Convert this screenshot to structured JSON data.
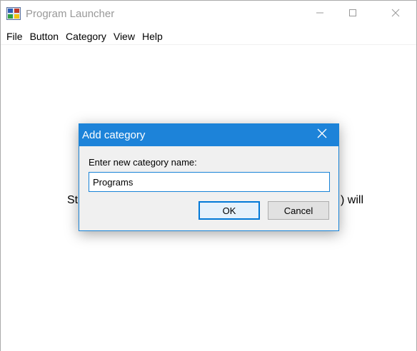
{
  "window": {
    "title": "Program Launcher"
  },
  "menu": {
    "items": [
      "File",
      "Button",
      "Category",
      "View",
      "Help"
    ]
  },
  "background": {
    "text_left": "St",
    "text_right": ") will"
  },
  "dialog": {
    "title": "Add category",
    "prompt": "Enter new category name:",
    "input_value": "Programs",
    "ok_label": "OK",
    "cancel_label": "Cancel"
  },
  "colors": {
    "dialog_titlebar": "#1d83d9",
    "accent": "#0078d7",
    "dialog_bg": "#f0f0f0"
  },
  "icons": {
    "app": "program-launcher-icon",
    "minimize": "minimize-icon",
    "maximize": "maximize-icon",
    "close": "close-icon"
  }
}
